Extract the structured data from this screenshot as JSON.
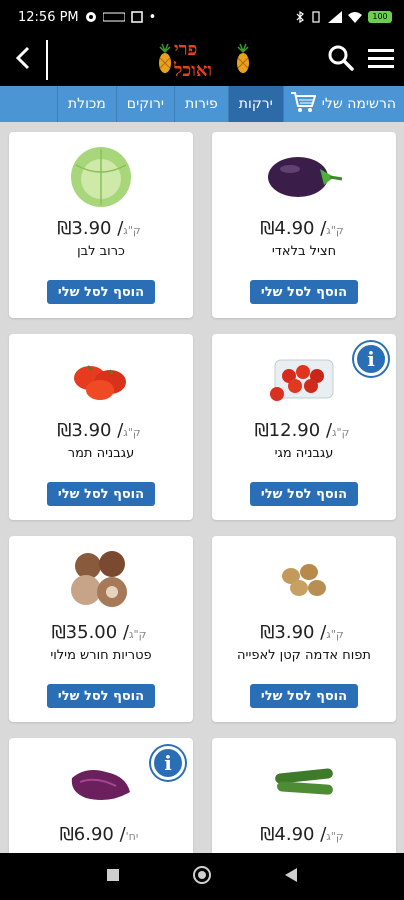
{
  "status": {
    "time": "12:56 PM",
    "battery": "100"
  },
  "header": {
    "logo_text": "פרי ואוכל",
    "icons": [
      "back-icon",
      "search-icon",
      "menu-icon"
    ]
  },
  "tabs": [
    {
      "label": "הרשימה שלי",
      "active": false
    },
    {
      "label": "ירקות",
      "active": true
    },
    {
      "label": "פירות",
      "active": false
    },
    {
      "label": "ירוקים",
      "active": false
    },
    {
      "label": "מכולת",
      "active": false
    }
  ],
  "products": [
    {
      "name": "חציל בלאדי",
      "price": "₪4.90",
      "unit": "ק\"ג",
      "button": "הוסף לסל שלי",
      "info": false,
      "icon": "eggplant-icon"
    },
    {
      "name": "כרוב לבן",
      "price": "₪3.90",
      "unit": "ק\"ג",
      "button": "הוסף לסל שלי",
      "info": false,
      "icon": "cabbage-icon"
    },
    {
      "name": "עגבניה מגי",
      "price": "₪12.90",
      "unit": "ק\"ג",
      "button": "הוסף לסל שלי",
      "info": true,
      "icon": "cherry-tomato-pack-icon"
    },
    {
      "name": "עגבניה תמר",
      "price": "₪3.90",
      "unit": "ק\"ג",
      "button": "הוסף לסל שלי",
      "info": false,
      "icon": "tomato-icon"
    },
    {
      "name": "תפוח אדמה קטן לאפייה",
      "price": "₪3.90",
      "unit": "ק\"ג",
      "button": "הוסף לסל שלי",
      "info": false,
      "icon": "potato-icon"
    },
    {
      "name": "פטריות חורש מילוי",
      "price": "₪35.00",
      "unit": "ק\"ג",
      "button": "הוסף לסל שלי",
      "info": false,
      "icon": "mushroom-icon"
    },
    {
      "name": "",
      "price": "₪4.90",
      "unit": "ק\"ג",
      "button": "",
      "info": false,
      "icon": "zucchini-icon"
    },
    {
      "name": "",
      "price": "₪6.90",
      "unit": "יח'",
      "button": "",
      "info": true,
      "icon": "red-cabbage-pack-icon"
    }
  ],
  "colors": {
    "tab_bar": "#4b95d4",
    "tab_active": "#2c6aa8",
    "button": "#2a6fb5",
    "logo": "#e8401c"
  }
}
